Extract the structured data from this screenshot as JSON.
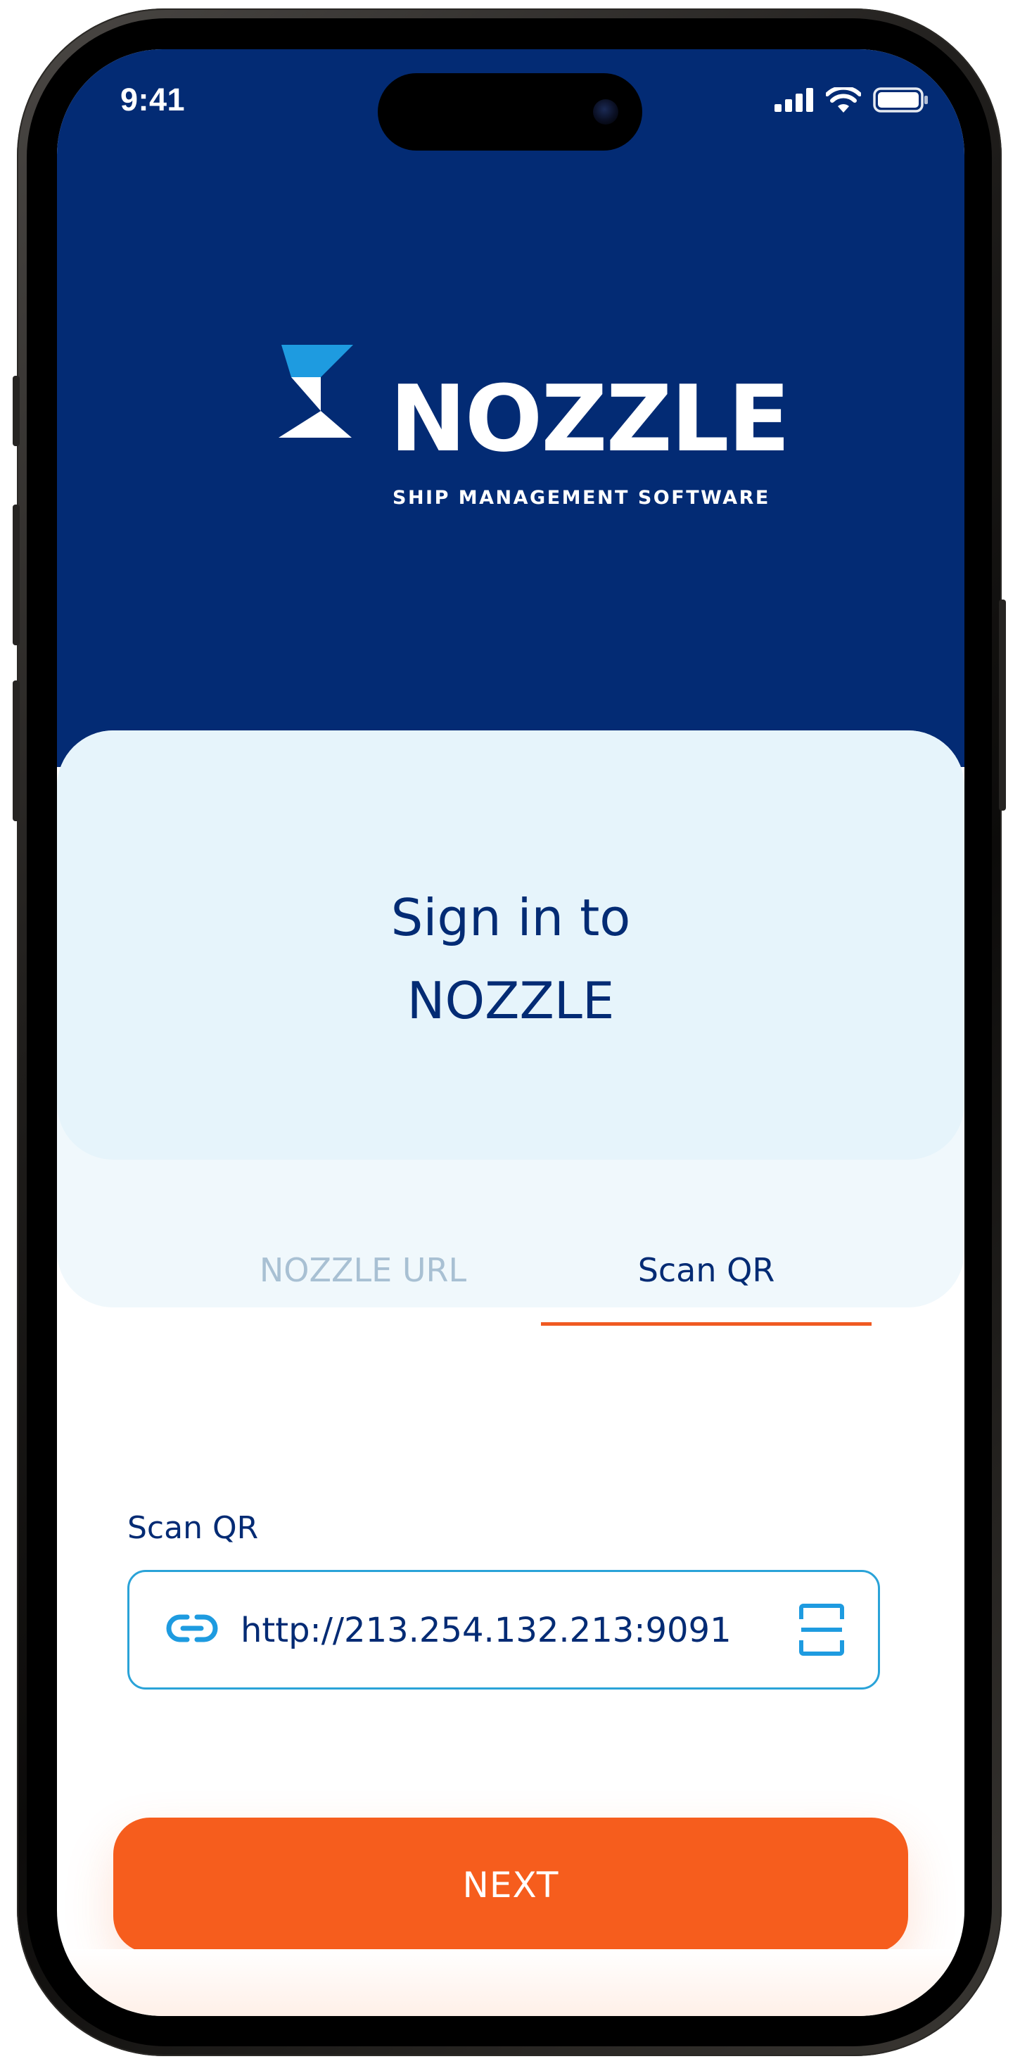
{
  "status_bar": {
    "time": "9:41",
    "icons": [
      "signal-icon",
      "wifi-icon",
      "battery-icon"
    ]
  },
  "header": {
    "brand": "NOZZLE",
    "tagline": "SHIP MANAGEMENT SOFTWARE",
    "logo_colors": {
      "accent": "#1e9be0",
      "mark": "#ffffff",
      "background": "#032b74"
    }
  },
  "signin": {
    "title_line1": "Sign in to",
    "title_line2": "NOZZLE"
  },
  "tabs": [
    {
      "label": "NOZZLE URL",
      "active": false
    },
    {
      "label": "Scan QR",
      "active": true
    }
  ],
  "form": {
    "label": "Scan QR",
    "url_value": "http://213.254.132.213:9091",
    "leading_icon": "link-icon",
    "trailing_icon": "scan-qr-icon"
  },
  "actions": {
    "next_label": "NEXT"
  },
  "colors": {
    "primary": "#032b74",
    "accent": "#f65d1d",
    "field_border": "#2aa3d8",
    "inactive_tab": "#a8c0d3"
  }
}
